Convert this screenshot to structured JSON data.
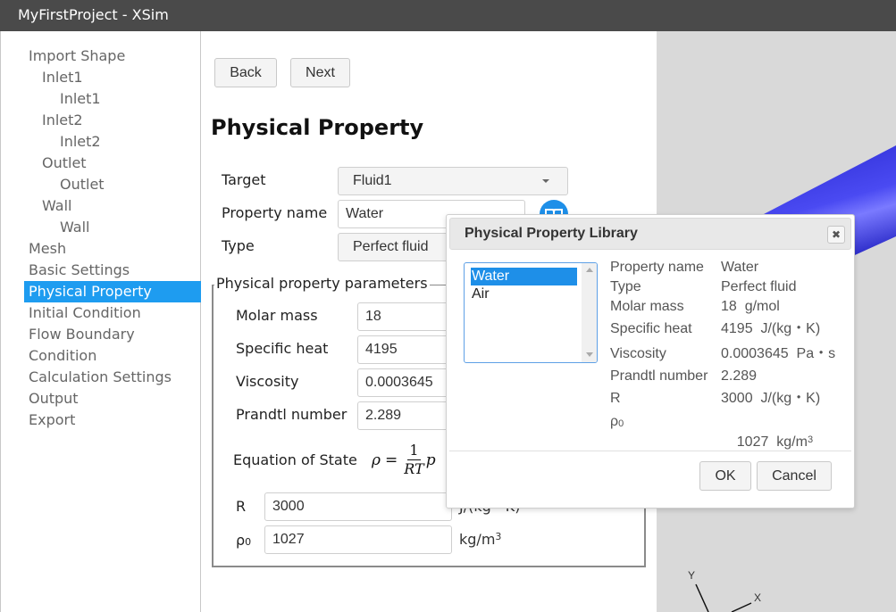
{
  "window": {
    "title": "MyFirstProject - XSim"
  },
  "sidebar": {
    "items": [
      {
        "label": "Import Shape",
        "level": 0,
        "active": false
      },
      {
        "label": "Inlet1",
        "level": 1,
        "active": false
      },
      {
        "label": "Inlet1",
        "level": 2,
        "active": false
      },
      {
        "label": "Inlet2",
        "level": 1,
        "active": false
      },
      {
        "label": "Inlet2",
        "level": 2,
        "active": false
      },
      {
        "label": "Outlet",
        "level": 1,
        "active": false
      },
      {
        "label": "Outlet",
        "level": 2,
        "active": false
      },
      {
        "label": "Wall",
        "level": 1,
        "active": false
      },
      {
        "label": "Wall",
        "level": 2,
        "active": false
      },
      {
        "label": "Mesh",
        "level": 0,
        "active": false
      },
      {
        "label": "Basic Settings",
        "level": 0,
        "active": false
      },
      {
        "label": "Physical Property",
        "level": 0,
        "active": true
      },
      {
        "label": "Initial Condition",
        "level": 0,
        "active": false
      },
      {
        "label": "Flow Boundary",
        "level": 0,
        "active": false
      },
      {
        "label": "Condition",
        "level": 0,
        "active": false
      },
      {
        "label": "Calculation Settings",
        "level": 0,
        "active": false
      },
      {
        "label": "Output",
        "level": 0,
        "active": false
      },
      {
        "label": "Export",
        "level": 0,
        "active": false
      }
    ]
  },
  "main": {
    "back_label": "Back",
    "next_label": "Next",
    "title": "Physical Property",
    "target": {
      "label": "Target",
      "value": "Fluid1"
    },
    "property_name": {
      "label": "Property name",
      "value": "Water"
    },
    "type": {
      "label": "Type",
      "value": "Perfect fluid"
    },
    "params": {
      "legend": "Physical property parameters",
      "molar_mass": {
        "label": "Molar mass",
        "value": "18"
      },
      "specific_heat": {
        "label": "Specific heat",
        "value": "4195"
      },
      "viscosity": {
        "label": "Viscosity",
        "value": "0.0003645"
      },
      "prandtl": {
        "label": "Prandtl number",
        "value": "2.289"
      },
      "eos_label": "Equation of State",
      "eos": {
        "lhs": "ρ",
        "eq": "=",
        "num": "1",
        "den": "RT",
        "rhs": "p"
      },
      "r": {
        "label": "R",
        "value": "3000",
        "unit": "J/(kg・K)"
      },
      "rho0": {
        "label": "ρ",
        "sub": "0",
        "value": "1027",
        "unit": "kg/m",
        "unit_sup": "3"
      }
    }
  },
  "viewport": {
    "axis_x": "X",
    "axis_y": "Y",
    "model_color": "#3a3ae6",
    "background": "#d9d9d9"
  },
  "dialog": {
    "title": "Physical Property Library",
    "close_icon": "close-icon",
    "list": [
      {
        "label": "Water",
        "selected": true
      },
      {
        "label": "Air",
        "selected": false
      }
    ],
    "details": [
      {
        "key": "Property name",
        "value": "Water"
      },
      {
        "key": "Type",
        "value": "Perfect fluid"
      },
      {
        "key": "Molar mass",
        "value": "18  g/mol"
      },
      {
        "key": "Specific heat",
        "value": "4195  J/(kg・K)"
      },
      {
        "key": "Viscosity",
        "value": "0.0003645  Pa・s"
      },
      {
        "key": "Prandtl number",
        "value": "2.289"
      },
      {
        "key": "R",
        "value": "3000  J/(kg・K)"
      }
    ],
    "rho0": {
      "key": "ρ",
      "key_sub": "0",
      "value": "1027  kg/m",
      "value_sup": "3"
    },
    "ok_label": "OK",
    "cancel_label": "Cancel"
  },
  "colors": {
    "accent": "#1e9cf0",
    "titlebar": "#4a4a4a"
  }
}
